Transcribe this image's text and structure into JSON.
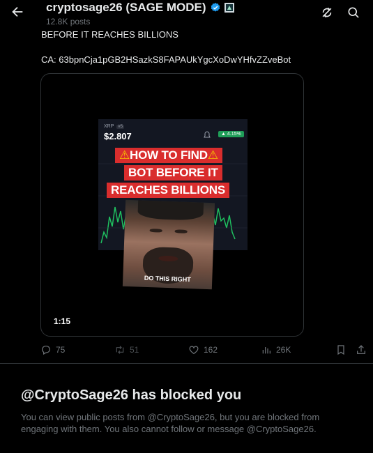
{
  "header": {
    "title": "cryptosage26 (SAGE MODE)",
    "post_count": "12.8K posts"
  },
  "tweet": {
    "line1": "BEFORE IT REACHES BILLIONS",
    "line2": "CA: 63bpnCja1pGB2HSazkS8FAPAUkYgcXoDwYHfvZZveBot"
  },
  "video": {
    "duration": "1:15",
    "ticker": "XRP",
    "price": "$2.807",
    "percent_change": "▲ 4.15%",
    "banner_line1": "HOW TO FIND",
    "banner_line2": "BOT BEFORE IT",
    "banner_line3": "REACHES BILLIONS",
    "caption": "DO THIS RIGHT"
  },
  "actions": {
    "replies": "75",
    "reposts": "51",
    "likes": "162",
    "views": "26K"
  },
  "blocked": {
    "title": "@CryptoSage26 has blocked you",
    "body": "You can view public posts from @CryptoSage26, but you are blocked from engaging with them. You also cannot follow or message @CryptoSage26."
  },
  "colors": {
    "background": "#000000",
    "text_primary": "#e7e9ea",
    "text_secondary": "#71767b",
    "verified_blue": "#1d9bf0",
    "banner_red": "#d92d2d",
    "chart_green": "#1f9e58"
  },
  "icons": [
    "back-arrow-icon",
    "verified-badge-icon",
    "affiliate-badge-icon",
    "refresh-icon",
    "search-icon",
    "reply-icon",
    "repost-icon",
    "like-icon",
    "views-icon",
    "bookmark-icon",
    "share-icon"
  ]
}
